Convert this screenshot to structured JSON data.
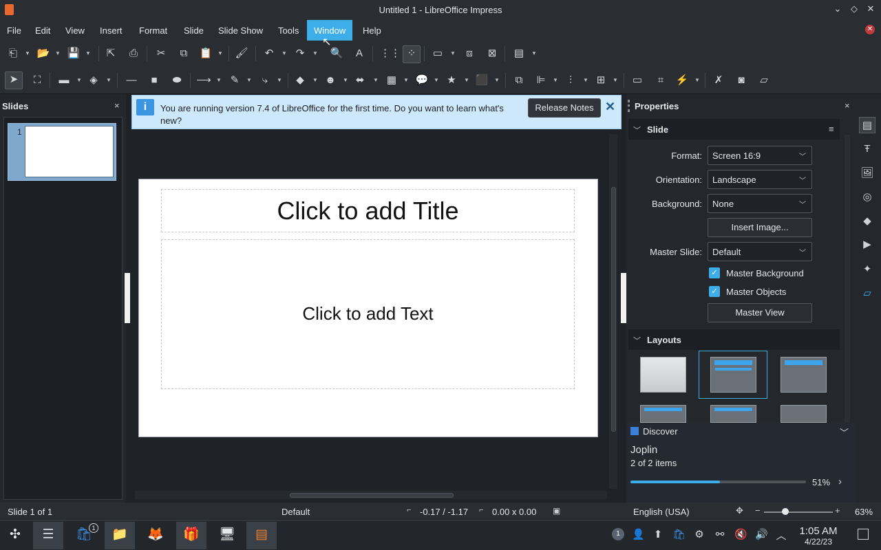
{
  "window": {
    "title": "Untitled 1 - LibreOffice Impress"
  },
  "menu": [
    "File",
    "Edit",
    "View",
    "Insert",
    "Format",
    "Slide",
    "Slide Show",
    "Tools",
    "Window",
    "Help"
  ],
  "slides_panel": {
    "title": "Slides",
    "close": "×",
    "slide_number": "1"
  },
  "infobar": {
    "icon": "i",
    "message": "You are running version 7.4 of LibreOffice for the first time. Do you want to learn what's new?",
    "button": "Release Notes",
    "close": "✕"
  },
  "slide": {
    "title_placeholder": "Click to add Title",
    "text_placeholder": "Click to add Text"
  },
  "properties": {
    "title": "Properties",
    "close": "×",
    "slide_section": "Slide",
    "format_label": "Format:",
    "format_value": "Screen 16:9",
    "orientation_label": "Orientation:",
    "orientation_value": "Landscape",
    "background_label": "Background:",
    "background_value": "None",
    "insert_image": "Insert Image...",
    "master_slide_label": "Master Slide:",
    "master_slide_value": "Default",
    "master_background": "Master Background",
    "master_objects": "Master Objects",
    "master_view": "Master View",
    "layouts_section": "Layouts"
  },
  "discover": {
    "header": "Discover",
    "app": "Joplin",
    "count": "2 of 2 items",
    "progress_pct": 51,
    "progress_label": "51%"
  },
  "status": {
    "slide": "Slide 1 of 1",
    "master": "Default",
    "position": "-0.17 / -1.17",
    "size": "0.00 x 0.00",
    "language": "English (USA)",
    "zoom": "63%"
  },
  "taskbar": {
    "badge": "1",
    "tray_badge": "1",
    "time": "1:05 AM",
    "date": "4/22/23"
  },
  "colors": {
    "accent": "#3daee9",
    "infobar": "#cde8fb",
    "panel": "#24272c",
    "slide": "#ffffff"
  }
}
